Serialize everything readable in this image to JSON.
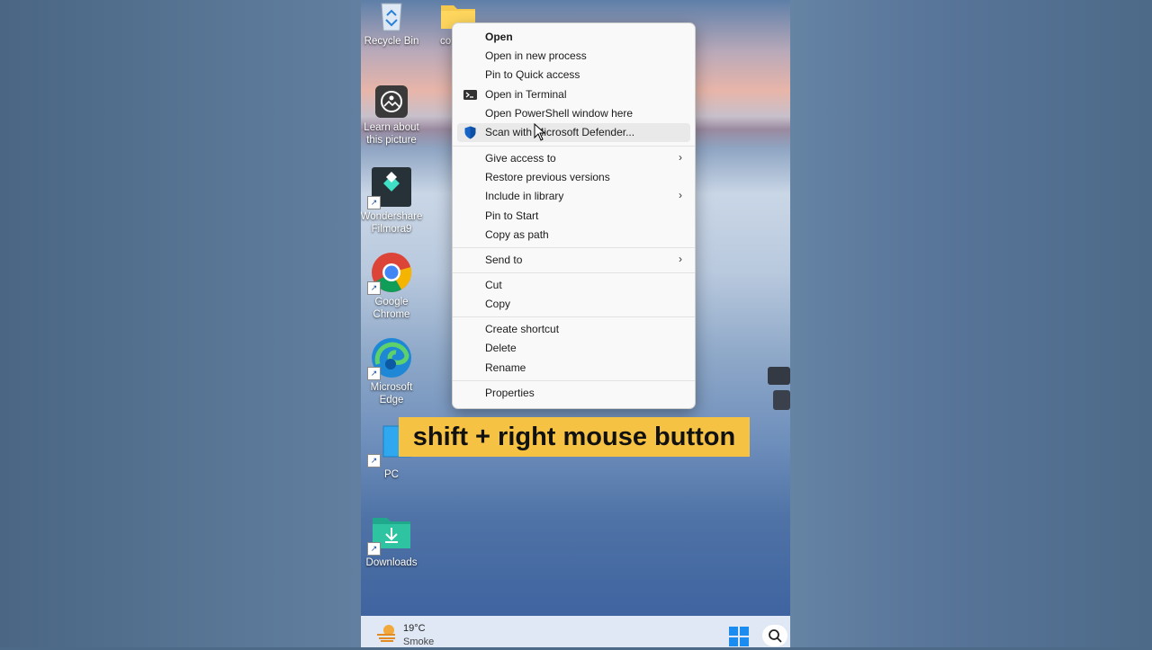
{
  "desktop": {
    "icons": [
      {
        "label": "Recycle Bin",
        "icon": "recycle-bin-icon"
      },
      {
        "label": "co",
        "icon": "folder-icon"
      },
      {
        "label": "Learn about this picture",
        "icon": "learn-about-picture-icon"
      },
      {
        "label": "Wondershare Filmora9",
        "icon": "filmora-icon"
      },
      {
        "label": "Google Chrome",
        "icon": "chrome-icon"
      },
      {
        "label": "Microsoft Edge",
        "icon": "edge-icon"
      },
      {
        "label": "PC",
        "icon": "pc-icon"
      },
      {
        "label": "Downloads",
        "icon": "downloads-folder-icon"
      }
    ]
  },
  "context_menu": {
    "items": [
      {
        "label": "Open",
        "bold": true
      },
      {
        "label": "Open in new process"
      },
      {
        "label": "Pin to Quick access"
      },
      {
        "label": "Open in Terminal",
        "icon": "terminal-icon"
      },
      {
        "label": "Open PowerShell window here"
      },
      {
        "label": "Scan with Microsoft Defender...",
        "icon": "defender-shield-icon",
        "hovered": true
      },
      {
        "label": "Give access to",
        "submenu": true
      },
      {
        "label": "Restore previous versions"
      },
      {
        "label": "Include in library",
        "submenu": true
      },
      {
        "label": "Pin to Start"
      },
      {
        "label": "Copy as path"
      },
      {
        "label": "Send to",
        "submenu": true
      },
      {
        "label": "Cut"
      },
      {
        "label": "Copy"
      },
      {
        "label": "Create shortcut"
      },
      {
        "label": "Delete"
      },
      {
        "label": "Rename"
      },
      {
        "label": "Properties"
      }
    ],
    "submenu_arrow": "›"
  },
  "caption": {
    "text": "shift + right mouse button"
  },
  "taskbar": {
    "weather": {
      "temperature": "19°C",
      "condition": "Smoke"
    }
  },
  "colors": {
    "caption_bg": "#f5c244",
    "menu_bg": "#f9f9f9",
    "taskbar_bg": "#dfe8f4",
    "accent": "#0f6cbd"
  }
}
